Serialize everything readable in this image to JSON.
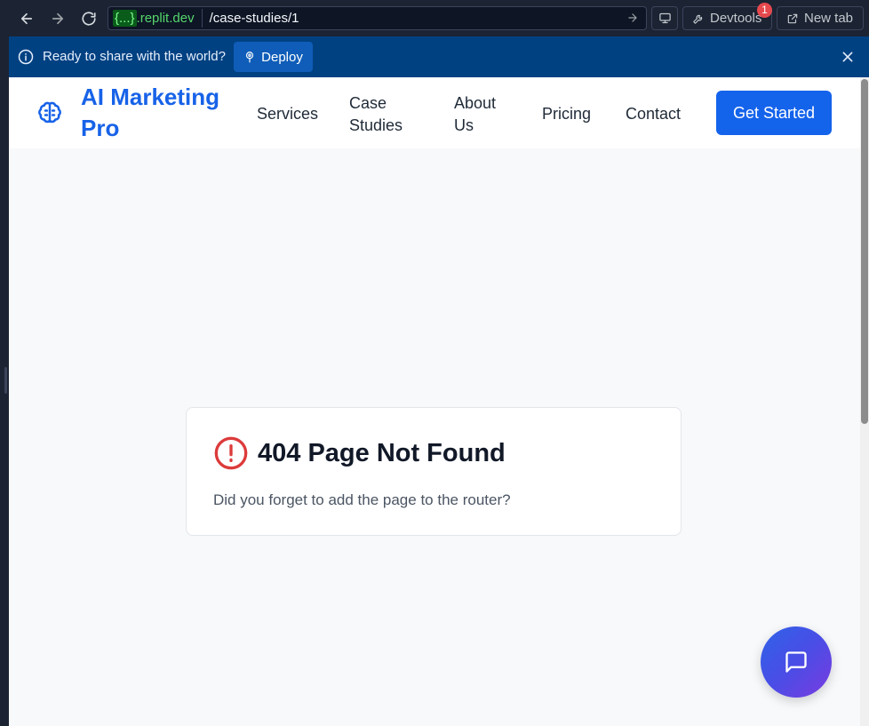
{
  "browser": {
    "url_host_braces": "{...}",
    "url_host_domain": ".replit.dev",
    "url_path": "/case-studies/1",
    "devtools_label": "Devtools",
    "devtools_badge": "1",
    "newtab_label": "New tab"
  },
  "banner": {
    "message": "Ready to share with the world?",
    "deploy_label": "Deploy"
  },
  "site": {
    "logo_line1": "AI Marketing",
    "logo_line2": "Pro",
    "nav": [
      {
        "line1": "Services",
        "line2": ""
      },
      {
        "line1": "Case",
        "line2": "Studies"
      },
      {
        "line1": "About",
        "line2": "Us"
      },
      {
        "line1": "Pricing",
        "line2": ""
      },
      {
        "line1": "Contact",
        "line2": ""
      }
    ],
    "cta_label": "Get Started"
  },
  "error_card": {
    "title": "404 Page Not Found",
    "message": "Did you forget to add the page to the router?"
  },
  "colors": {
    "brand": "#1762e8",
    "error": "#dc3b3b",
    "banner": "#004182"
  }
}
